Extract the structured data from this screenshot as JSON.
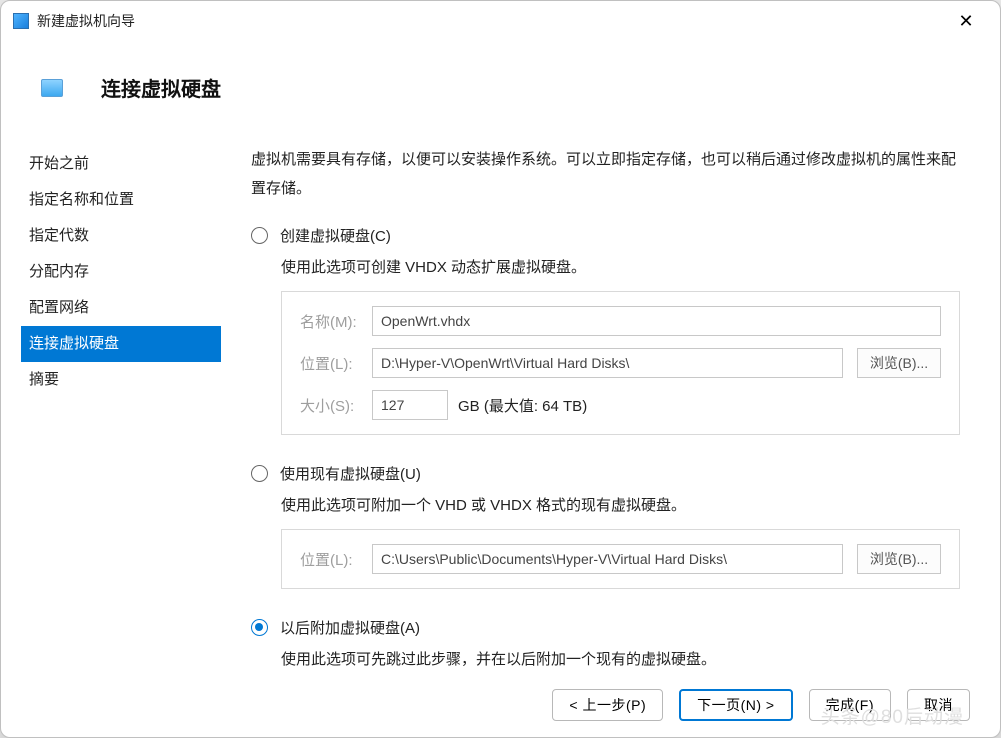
{
  "window": {
    "title": "新建虚拟机向导"
  },
  "header": {
    "title": "连接虚拟硬盘"
  },
  "sidebar": {
    "steps": [
      "开始之前",
      "指定名称和位置",
      "指定代数",
      "分配内存",
      "配置网络",
      "连接虚拟硬盘",
      "摘要"
    ],
    "active_index": 5
  },
  "content": {
    "intro": "虚拟机需要具有存储，以便可以安装操作系统。可以立即指定存储，也可以稍后通过修改虚拟机的属性来配置存储。",
    "options": {
      "create": {
        "label": "创建虚拟硬盘(C)",
        "desc": "使用此选项可创建 VHDX 动态扩展虚拟硬盘。",
        "name_label": "名称(M):",
        "name_value": "OpenWrt.vhdx",
        "loc_label": "位置(L):",
        "loc_value": "D:\\Hyper-V\\OpenWrt\\Virtual Hard Disks\\",
        "browse": "浏览(B)...",
        "size_label": "大小(S):",
        "size_value": "127",
        "size_unit": "GB (最大值: 64 TB)"
      },
      "existing": {
        "label": "使用现有虚拟硬盘(U)",
        "desc": "使用此选项可附加一个 VHD 或 VHDX 格式的现有虚拟硬盘。",
        "loc_label": "位置(L):",
        "loc_value": "C:\\Users\\Public\\Documents\\Hyper-V\\Virtual Hard Disks\\",
        "browse": "浏览(B)..."
      },
      "later": {
        "label": "以后附加虚拟硬盘(A)",
        "desc": "使用此选项可先跳过此步骤，并在以后附加一个现有的虚拟硬盘。"
      },
      "selected": "later"
    }
  },
  "footer": {
    "prev": "< 上一步(P)",
    "next": "下一页(N) >",
    "finish": "完成(F)",
    "cancel": "取消"
  },
  "watermark": "头条@80后动漫"
}
